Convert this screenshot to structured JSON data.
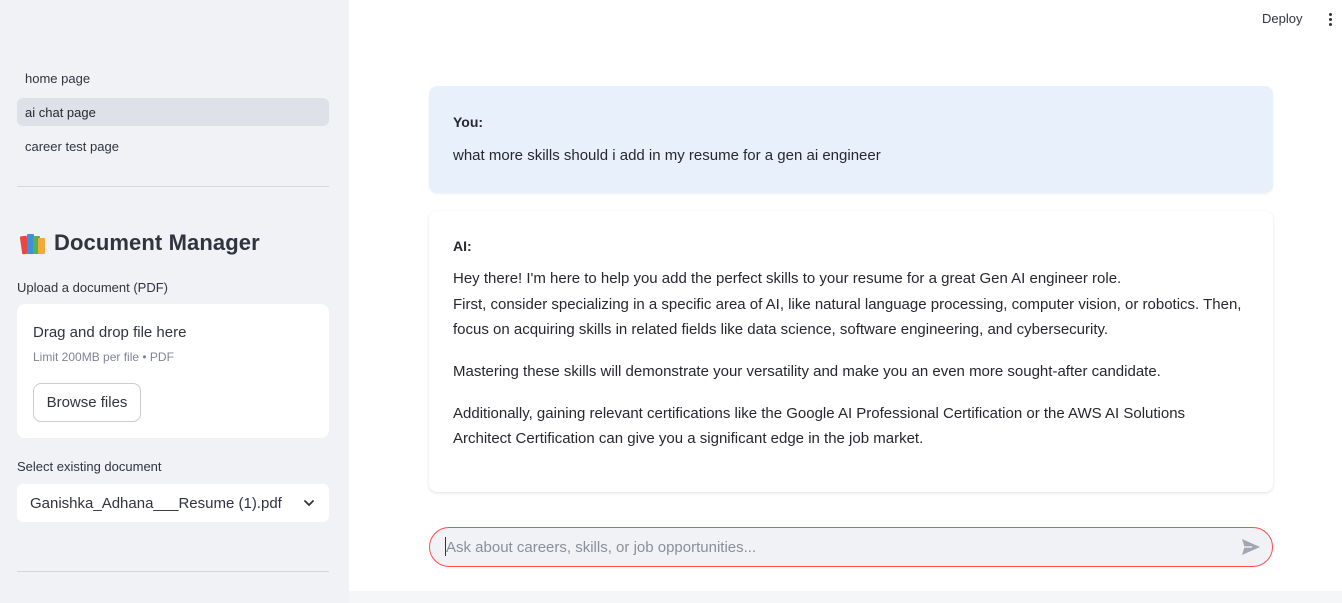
{
  "sidebar": {
    "nav": [
      "home page",
      "ai chat page",
      "career test page"
    ],
    "active_index": 1,
    "doc_manager": {
      "icon": "books-icon",
      "title": "Document Manager",
      "upload_label": "Upload a document (PDF)",
      "dropzone_title": "Drag and drop file here",
      "dropzone_limit": "Limit 200MB per file • PDF",
      "browse_label": "Browse files",
      "select_label": "Select existing document",
      "selected_document": "Ganishka_Adhana___Resume (1).pdf"
    }
  },
  "topbar": {
    "deploy_label": "Deploy",
    "menu_icon": "kebab-menu-icon"
  },
  "chat": {
    "user": {
      "speaker": "You:",
      "text": "what more skills should i add in my resume for a gen ai engineer"
    },
    "ai": {
      "speaker": "AI:",
      "lines": [
        "Hey there! I'm here to help you add the perfect skills to your resume for a great Gen AI engineer role.",
        "First, consider specializing in a specific area of AI, like natural language processing, computer vision, or robotics. Then,",
        "focus on acquiring skills in related fields like data science, software engineering, and cybersecurity.",
        "Mastering these skills will demonstrate your versatility and make you an even more sought-after candidate.",
        "Additionally, gaining relevant certifications like the Google AI Professional Certification or the AWS AI Solutions",
        "Architect Certification can give you a significant edge in the job market."
      ]
    },
    "input_placeholder": "Ask about careers, skills, or job opportunities...",
    "input_value": "",
    "send_icon": "send-icon"
  },
  "colors": {
    "accent": "#ff4b4b",
    "sidebar_bg": "#f0f2f6",
    "user_bubble": "#e8f1fb"
  }
}
